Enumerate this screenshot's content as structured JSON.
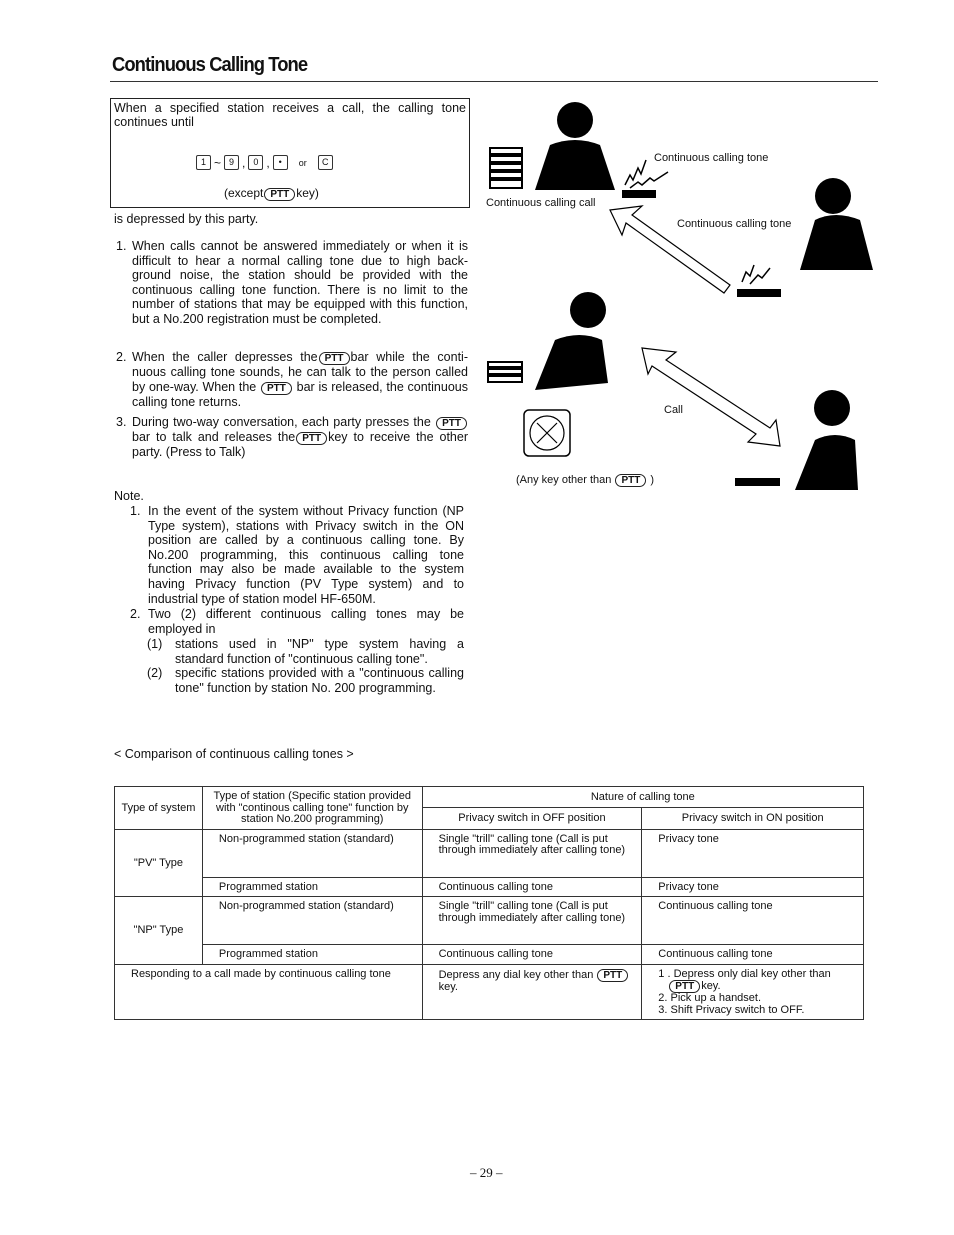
{
  "title": "Continuous Calling Tone",
  "intro": {
    "text": "When a specified station receives a call, the calling tone continues until",
    "keys": [
      "1",
      "9",
      "0",
      "•",
      "C"
    ],
    "tilde": "~",
    "comma": ",",
    "or": "or",
    "except_prefix": "(except",
    "except_suffix": "key)",
    "after": "is depressed by this party."
  },
  "ptt": "PTT",
  "items": [
    {
      "n": "1.",
      "text": "When calls cannot be answered immediately or when it is difficult to hear a normal calling tone due to high back-ground noise, the station should be provided with the continuous calling tone function. There is no limit to the number of stations that may be equipped with this function, but a No.200 registration must be completed."
    },
    {
      "n": "2.",
      "a": "When the caller depresses the",
      "b": "bar while the conti-nuous calling tone sounds, he can talk to the person called by one-way. When the",
      "c": "bar is released, the continuous calling tone returns."
    },
    {
      "n": "3.",
      "a": "During two-way conversation, each party presses the",
      "b": "bar to talk and releases the",
      "c": "key to receive the other party. (Press to Talk)"
    }
  ],
  "note": {
    "heading": "Note.",
    "items": [
      {
        "n": "1.",
        "text": "In the event of the system without Privacy function (NP Type system), stations with Privacy switch in the ON position are called by a continuous calling tone. By No.200 programming, this continuous calling tone function may also be made available to the system having Privacy function (PV Type system) and to industrial type of station model HF-650M."
      },
      {
        "n": "2.",
        "text": "Two (2) different continuous calling tones may be employed in"
      }
    ],
    "sub_items": [
      {
        "n": "(1)",
        "text": "stations used in \"NP\" type system having a standard function of \"continuous calling tone\"."
      },
      {
        "n": "(2)",
        "text": "specific stations provided with a \"continuous calling tone\" function by station No. 200 programming."
      }
    ]
  },
  "figure": {
    "label_call_origin": "Continuous calling call",
    "label_tone_1": "Continuous calling tone",
    "label_tone_2": "Continuous calling tone",
    "label_call": "Call",
    "label_any_key_prefix": "(Any key other than",
    "label_any_key_suffix": ")"
  },
  "comparison": {
    "heading": "< Comparison of continuous calling tones >",
    "headers": {
      "system": "Type of system",
      "station": "Type of station (Specific station provided with \"continous calling tone\" function by station No.200 programming)",
      "nature": "Nature of calling tone",
      "off": "Privacy switch in OFF position",
      "on": "Privacy switch in ON position"
    },
    "rows": [
      {
        "system": "\"PV\" Type",
        "station": "Non-programmed station (standard)",
        "off": "Single \"trill\" calling tone (Call is put through immediately after calling tone)",
        "on": "Privacy tone"
      },
      {
        "station": "Programmed station",
        "off": "Continuous calling tone",
        "on": "Privacy tone"
      },
      {
        "system": "\"NP\" Type",
        "station": "Non-programmed station (standard)",
        "off": "Single \"trill\" calling tone (Call is put through immediately after calling tone)",
        "on": "Continuous calling tone"
      },
      {
        "station": "Programmed station",
        "off": "Continuous calling tone",
        "on": "Continuous calling tone"
      }
    ],
    "response": {
      "label": "Responding to a call made by continuous calling tone",
      "off_prefix": "Depress any dial key other than",
      "off_suffix": "key.",
      "on_1_prefix": "1 . Depress only dial key other than",
      "on_1_suffix": "key.",
      "on_2": "2. Pick up a handset.",
      "on_3": "3. Shift Privacy switch to OFF."
    }
  },
  "page_number": "– 29 –"
}
